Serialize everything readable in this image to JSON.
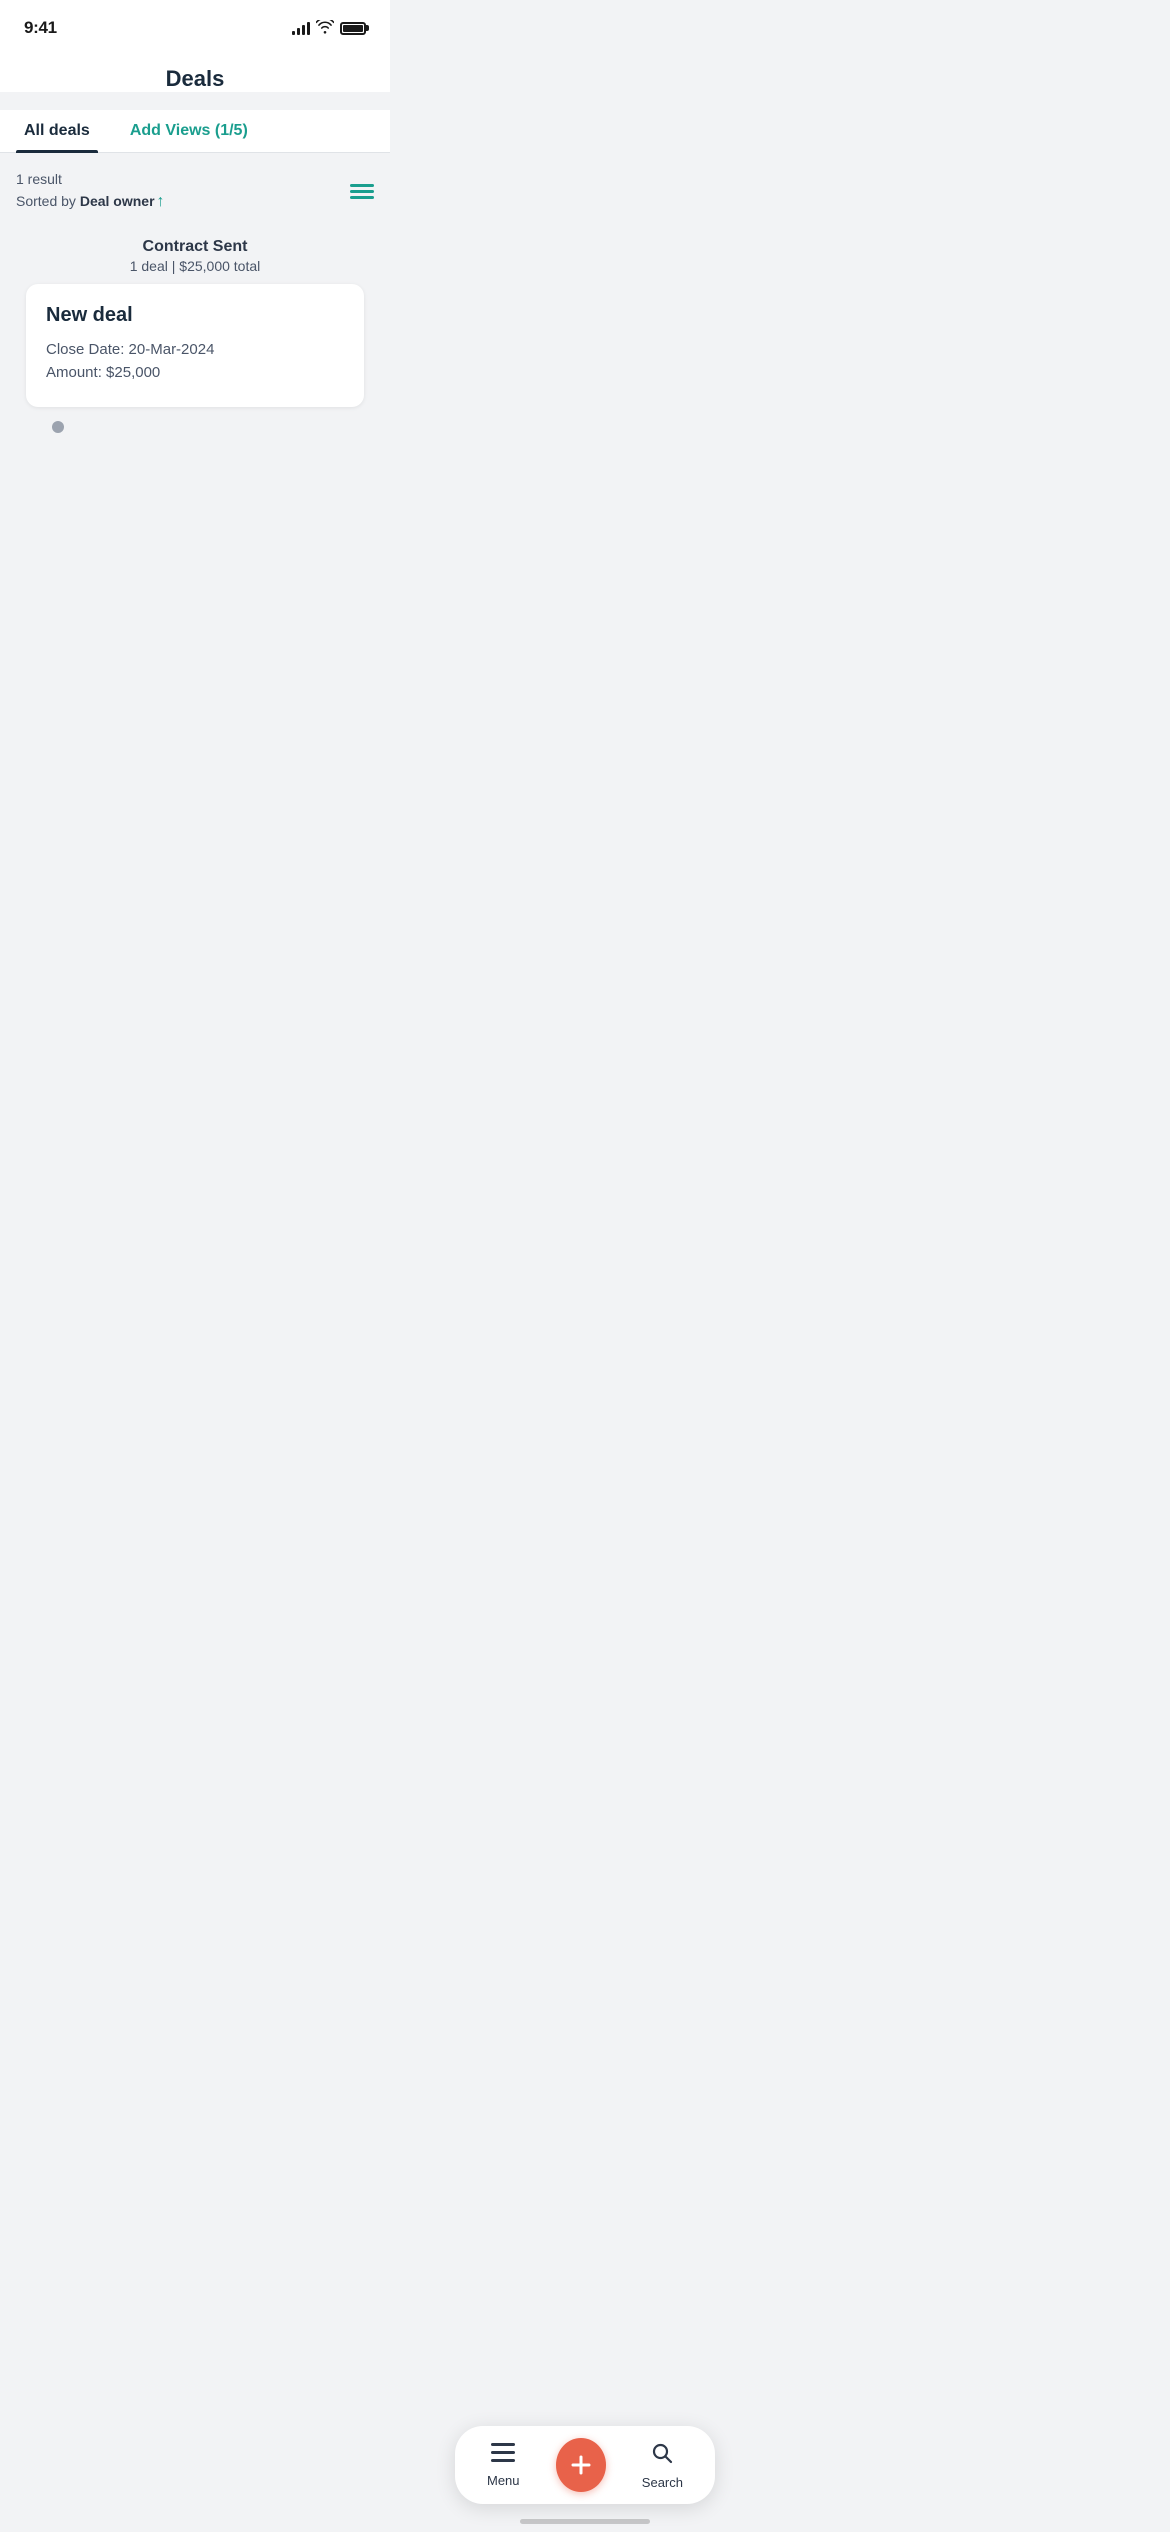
{
  "statusBar": {
    "time": "9:41",
    "battery": "full"
  },
  "header": {
    "title": "Deals"
  },
  "tabs": [
    {
      "id": "all-deals",
      "label": "All deals",
      "active": true
    },
    {
      "id": "add-views",
      "label": "Add Views (1/5)",
      "active": false
    }
  ],
  "results": {
    "count": "1 result",
    "sortPrefix": "Sorted by ",
    "sortField": "Deal owner",
    "sortDirection": "↑"
  },
  "stage": {
    "name": "Contract Sent",
    "dealCount": "1 deal",
    "totalAmount": "$25,000 total"
  },
  "deal": {
    "name": "New deal",
    "closeDateLabel": "Close Date:",
    "closeDate": "20-Mar-2024",
    "amountLabel": "Amount:",
    "amount": "$25,000"
  },
  "bottomNav": {
    "menuLabel": "Menu",
    "searchLabel": "Search",
    "addLabel": "+"
  }
}
